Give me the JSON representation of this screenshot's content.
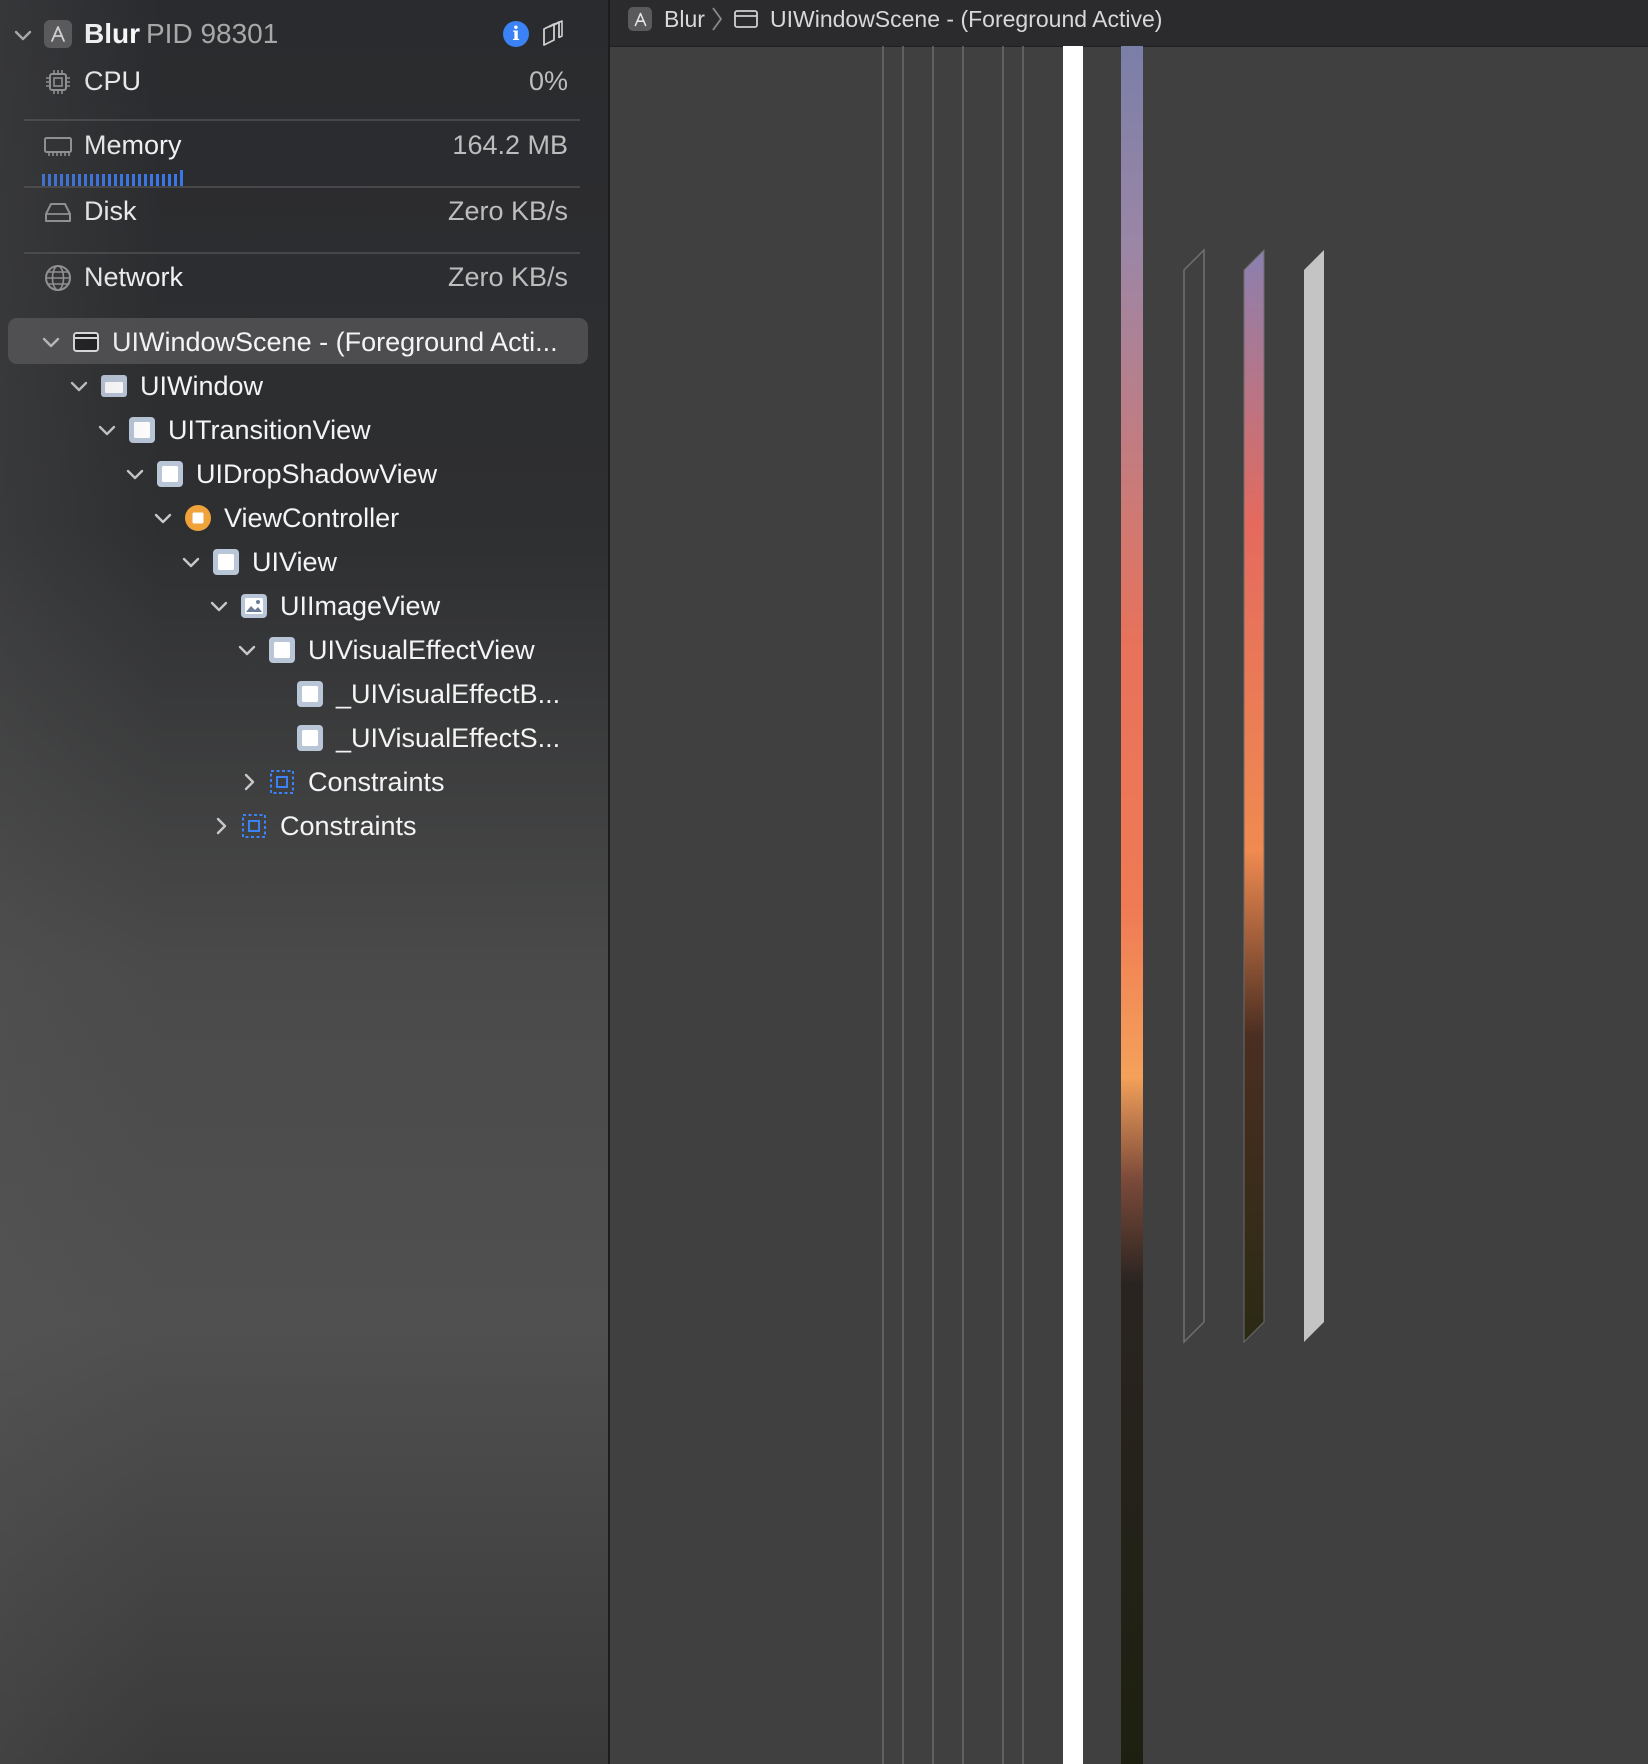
{
  "process": {
    "name": "Blur",
    "pid": "PID 98301"
  },
  "gauges": {
    "cpu": {
      "label": "CPU",
      "value": "0%"
    },
    "memory": {
      "label": "Memory",
      "value": "164.2 MB"
    },
    "disk": {
      "label": "Disk",
      "value": "Zero KB/s"
    },
    "network": {
      "label": "Network",
      "value": "Zero KB/s"
    }
  },
  "tree": [
    {
      "label": "UIWindowScene - (Foreground Acti...",
      "icon": "window-scene-icon",
      "expanded": true,
      "selected": true
    },
    {
      "label": "UIWindow",
      "icon": "window-icon",
      "expanded": true
    },
    {
      "label": "UITransitionView",
      "icon": "view-icon",
      "expanded": true
    },
    {
      "label": "UIDropShadowView",
      "icon": "view-icon",
      "expanded": true
    },
    {
      "label": "ViewController",
      "icon": "view-controller-icon",
      "expanded": true
    },
    {
      "label": "UIView",
      "icon": "view-icon",
      "expanded": true
    },
    {
      "label": "UIImageView",
      "icon": "image-view-icon",
      "expanded": true
    },
    {
      "label": "UIVisualEffectView",
      "icon": "view-icon",
      "expanded": true
    },
    {
      "label": "_UIVisualEffectB...",
      "icon": "view-icon"
    },
    {
      "label": "_UIVisualEffectS...",
      "icon": "view-icon"
    },
    {
      "label": "Constraints",
      "icon": "constraints-icon",
      "expanded": false
    },
    {
      "label": "Constraints",
      "icon": "constraints-icon",
      "expanded": false
    }
  ],
  "breadcrumb": {
    "app": "Blur",
    "scene": "UIWindowScene - (Foreground Active)"
  },
  "colors": {
    "accent": "#3b82f6",
    "memory_bar": "#3a76e6",
    "view_controller": "#f0a23b",
    "constraints": "#3b82f6"
  }
}
